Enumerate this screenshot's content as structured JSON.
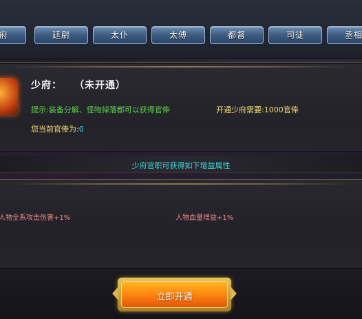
{
  "tabs": [
    {
      "label": "少府"
    },
    {
      "label": "廷尉"
    },
    {
      "label": "太仆"
    },
    {
      "label": "太傅"
    },
    {
      "label": "都督"
    },
    {
      "label": "司徒"
    },
    {
      "label": "丞相"
    }
  ],
  "office": {
    "name": "少府：",
    "status": "（未开通）",
    "hint_label": "提示:",
    "hint_text": "装备分解、怪物掉落都可以获得官俸",
    "require_label": "开通少府需要:",
    "require_value": "1000官俸",
    "current_label": "您当前官俸为:",
    "current_value": "0"
  },
  "section_title": "少府官职可获得如下增益属性",
  "attributes": [
    {
      "text": "人物全系攻击伤害+1%"
    },
    {
      "text": "人物血量增益+1%"
    }
  ],
  "activate_button": "立即开通",
  "colors": {
    "hint_green": "#5bd24a",
    "label_gold": "#f0dc7a",
    "value_cyan": "#3ee0e0",
    "attr_pink": "#e88a8a",
    "button_orange": "#ff8a0e"
  }
}
